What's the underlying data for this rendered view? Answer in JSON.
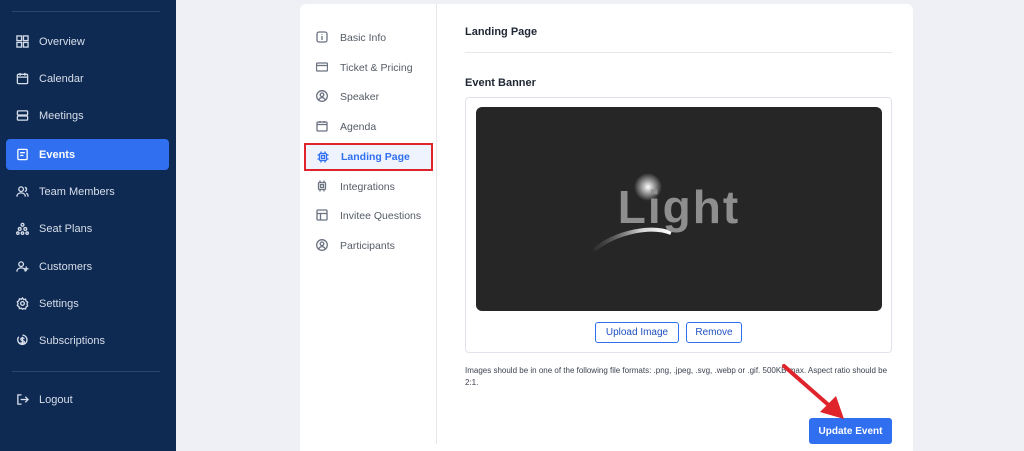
{
  "sidebar": {
    "items": [
      {
        "label": "Overview",
        "icon": "grid-icon"
      },
      {
        "label": "Calendar",
        "icon": "calendar-icon"
      },
      {
        "label": "Meetings",
        "icon": "server-icon"
      },
      {
        "label": "Events",
        "icon": "event-icon",
        "active": true
      },
      {
        "label": "Team Members",
        "icon": "users-icon"
      },
      {
        "label": "Seat Plans",
        "icon": "seats-icon"
      },
      {
        "label": "Customers",
        "icon": "user-plus-icon"
      },
      {
        "label": "Settings",
        "icon": "gear-icon"
      },
      {
        "label": "Subscriptions",
        "icon": "dollar-icon"
      }
    ],
    "logout_label": "Logout"
  },
  "sub_nav": {
    "items": [
      {
        "label": "Basic Info",
        "icon": "info-icon"
      },
      {
        "label": "Ticket & Pricing",
        "icon": "card-icon"
      },
      {
        "label": "Speaker",
        "icon": "user-circle-icon"
      },
      {
        "label": "Agenda",
        "icon": "calendar-icon"
      },
      {
        "label": "Landing Page",
        "icon": "chip-icon",
        "active": true
      },
      {
        "label": "Integrations",
        "icon": "chip-icon"
      },
      {
        "label": "Invitee Questions",
        "icon": "table-icon"
      },
      {
        "label": "Participants",
        "icon": "user-circle-icon"
      }
    ]
  },
  "content": {
    "section_title": "Landing Page",
    "banner_label": "Event Banner",
    "banner_image_text": "Light",
    "upload_button": "Upload Image",
    "remove_button": "Remove",
    "hint": "Images should be in one of the following file formats: .png, .jpeg, .svg, .webp or .gif. 500KB max. Aspect ratio should be 2:1.",
    "submit_button": "Update Event"
  },
  "colors": {
    "sidebar_bg": "#0e2a52",
    "accent": "#2f6ff0",
    "highlight_border": "#e0242b",
    "arrow": "#e0242b"
  }
}
